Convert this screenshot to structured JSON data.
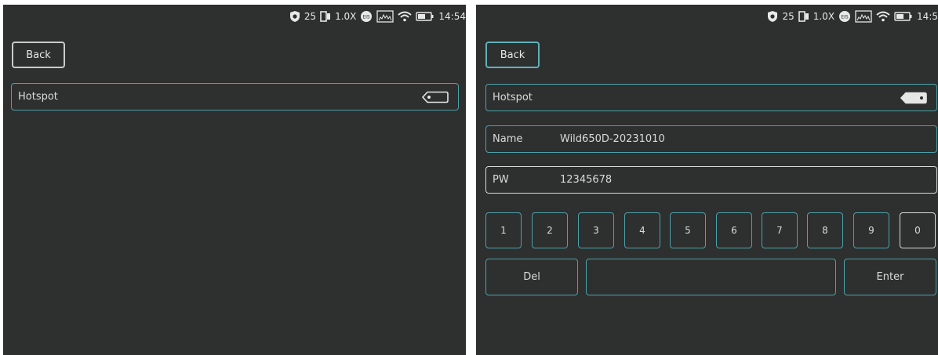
{
  "left_screen": {
    "status": {
      "battery_pct": "25",
      "zoom": "1.0X",
      "time": "14:54"
    },
    "back_label": "Back",
    "hotspot_label": "Hotspot",
    "hotspot_on": false
  },
  "right_screen": {
    "status": {
      "battery_pct": "25",
      "zoom": "1.0X",
      "time": "14:5"
    },
    "back_label": "Back",
    "hotspot_label": "Hotspot",
    "hotspot_on": true,
    "name_label": "Name",
    "name_value": "Wild650D-20231010",
    "pw_label": "PW",
    "pw_value": "12345678",
    "keys": [
      "1",
      "2",
      "3",
      "4",
      "5",
      "6",
      "7",
      "8",
      "9",
      "0"
    ],
    "del_label": "Del",
    "space_label": "",
    "enter_label": "Enter"
  },
  "colors": {
    "accent": "#4aa3ab",
    "background": "#2e2f2f",
    "text": "#d9dcdc"
  }
}
